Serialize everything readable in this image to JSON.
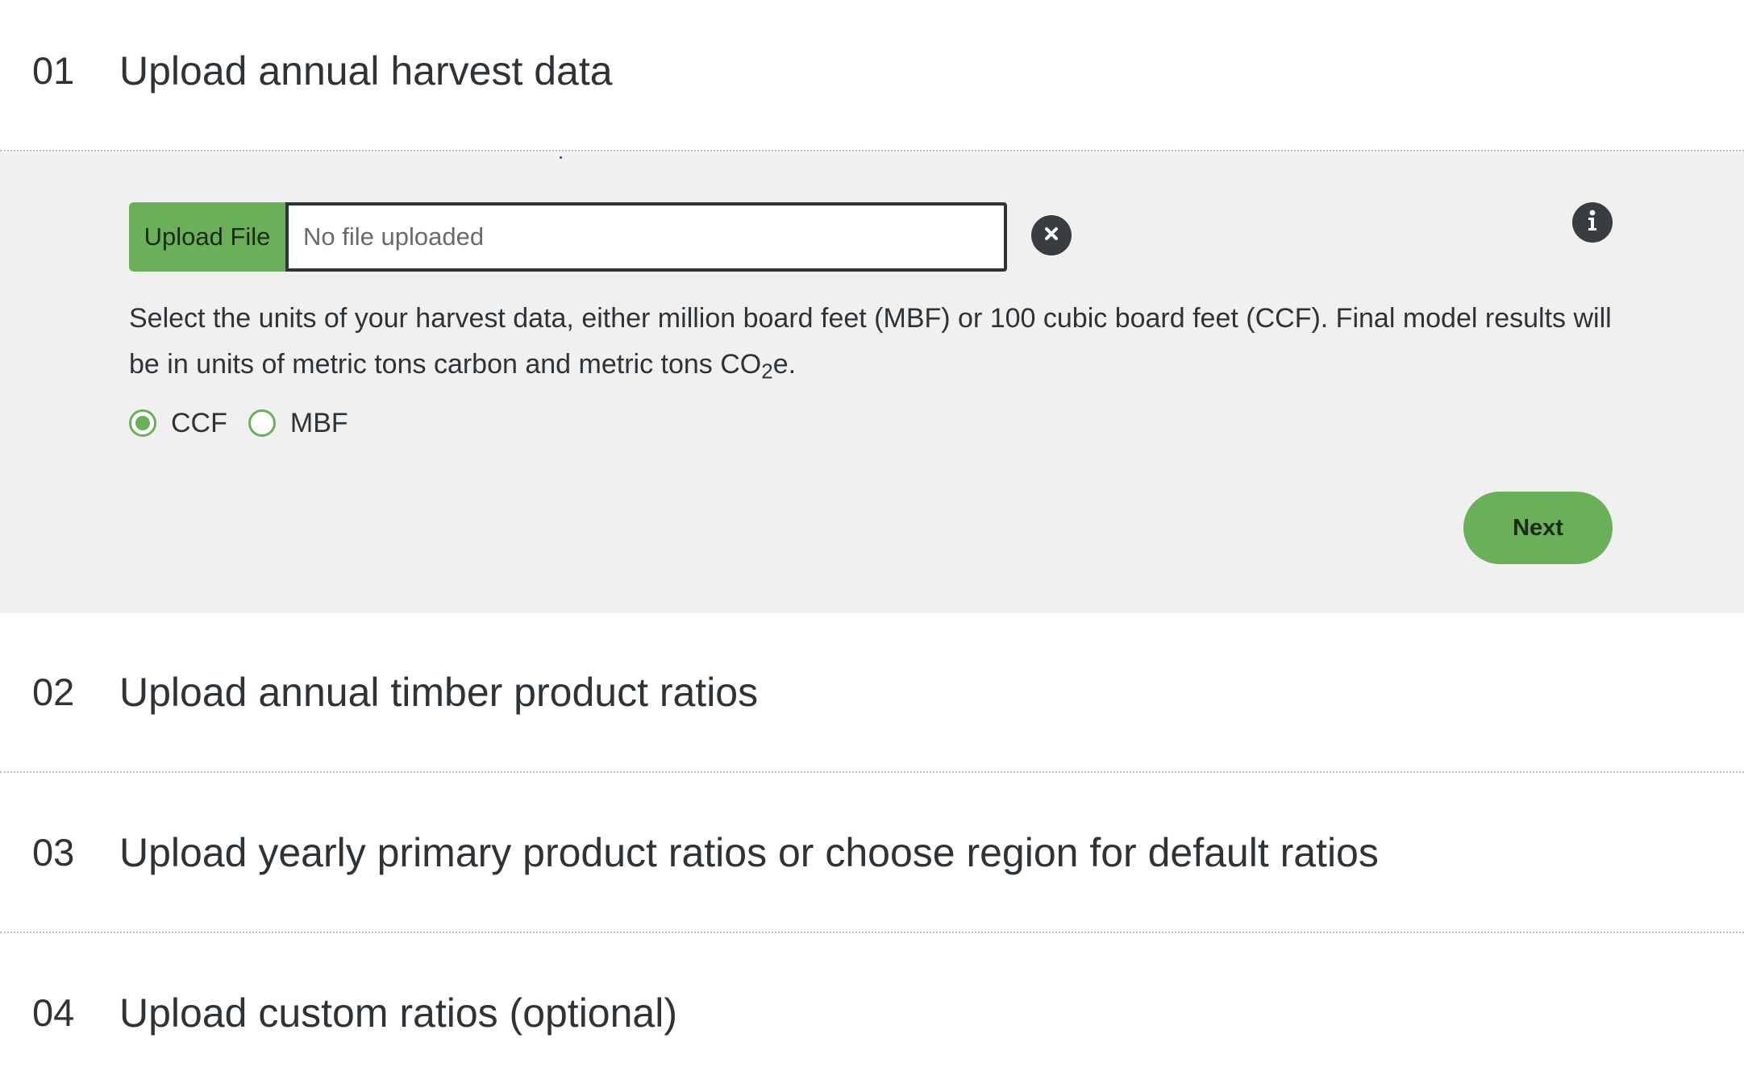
{
  "steps": [
    {
      "number": "01",
      "title": "Upload annual harvest data"
    },
    {
      "number": "02",
      "title": "Upload annual timber product ratios"
    },
    {
      "number": "03",
      "title": "Upload yearly primary product ratios or choose region for default ratios"
    },
    {
      "number": "04",
      "title": "Upload custom ratios (optional)"
    }
  ],
  "upload": {
    "button_label": "Upload File",
    "placeholder": "No file uploaded",
    "value": ""
  },
  "icons": {
    "clear": "close-icon",
    "info": "info-icon"
  },
  "description": {
    "text": "Select the units of your harvest data, either million board feet (MBF) or 100 cubic board feet (CCF). Final model results will be in units of metric tons carbon and metric tons CO",
    "sub": "2",
    "tail": "e."
  },
  "units": {
    "selected": "CCF",
    "options": [
      "CCF",
      "MBF"
    ]
  },
  "next_label": "Next",
  "colors": {
    "accent": "#6ab058",
    "panel_bg": "#f0f0f0",
    "text": "#2e3338",
    "icon_bg": "#3a3d40"
  }
}
